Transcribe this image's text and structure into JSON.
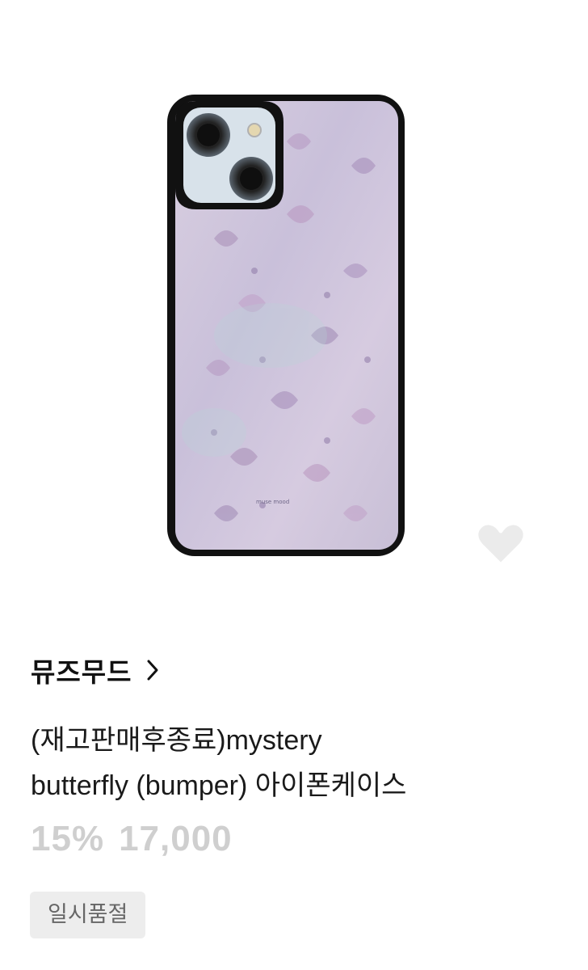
{
  "product": {
    "image_icon": "phone-case-photo",
    "wishlist_icon": "heart-outline-icon",
    "brand": "뮤즈무드",
    "brand_link_icon": "chevron-right-icon",
    "title_line1": "(재고판매후종료)mystery",
    "title_line2": "butterfly (bumper) 아이폰케이스",
    "discount": "15%",
    "price": "17,000",
    "status_badge": "일시품절",
    "case_print_text": "muse mood"
  },
  "colors": {
    "case_frame": "#111111",
    "price_text": "#cfcfcf",
    "badge_bg": "#ededed"
  }
}
